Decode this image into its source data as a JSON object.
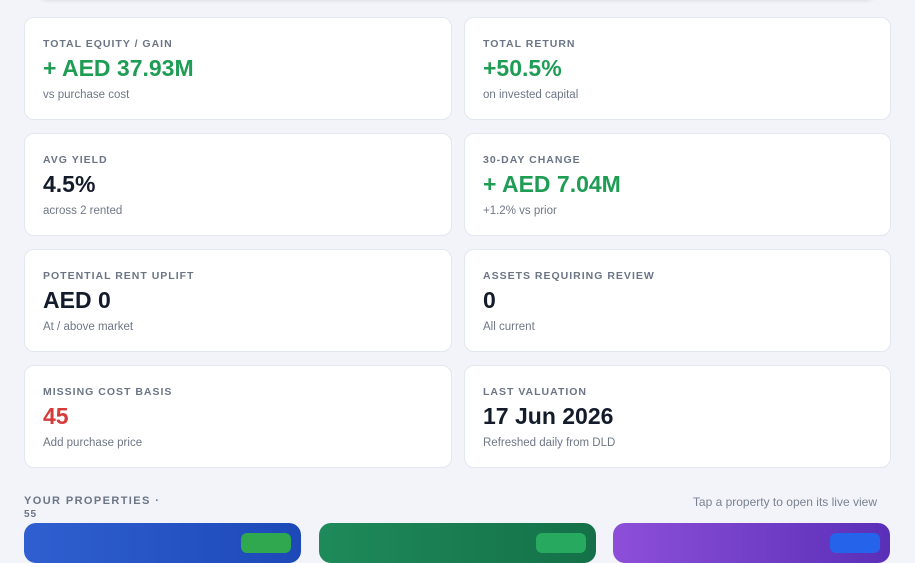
{
  "cards": [
    {
      "label": "TOTAL EQUITY / GAIN",
      "value": "+ AED 37.93M",
      "sub": "vs purchase cost"
    },
    {
      "label": "TOTAL RETURN",
      "value": "+50.5%",
      "sub": "on invested capital"
    },
    {
      "label": "AVG YIELD",
      "value": "4.5%",
      "sub": "across 2 rented"
    },
    {
      "label": "30-DAY CHANGE",
      "value": "+ AED 7.04M",
      "sub": "+1.2% vs prior"
    },
    {
      "label": "POTENTIAL RENT UPLIFT",
      "value": "AED 0",
      "sub": "At / above market"
    },
    {
      "label": "ASSETS REQUIRING REVIEW",
      "value": "0",
      "sub": "All current"
    },
    {
      "label": "MISSING COST BASIS",
      "value": "45",
      "sub": "Add purchase price"
    },
    {
      "label": "LAST VALUATION",
      "value": "17 Jun 2026",
      "sub": "Refreshed daily from DLD"
    }
  ],
  "properties": {
    "title": "YOUR PROPERTIES ·",
    "count": "55",
    "hint": "Tap a property to open its live view"
  },
  "colors": {
    "positive": "#1f9d55",
    "negative": "#d63b3b",
    "card_blue": "#2f5fd0",
    "card_green": "#1e8a5a",
    "card_purple": "#8d4fd8"
  }
}
